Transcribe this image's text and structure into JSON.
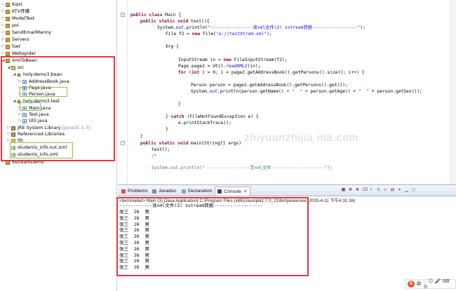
{
  "explorer": {
    "projects_top": [
      "Kqxt",
      "KTV开撑",
      "ModelTest",
      "poi",
      "SendEmailManny",
      "Servers",
      "Swt",
      "Webspider"
    ],
    "project": "XmlToBean",
    "src": "src",
    "pkg_bean": "holy.demo3.bean",
    "files_bean": [
      "AddressBook.java",
      "Page.java",
      "Person.java"
    ],
    "pkg_test": "holy.demo3.test",
    "files_test": [
      "Main.java",
      "Test.java",
      "Util.java"
    ],
    "jre": "JRE System Library",
    "jre_version": "[JavaSE-1.7]",
    "ref_libs": "Referenced Libraries",
    "lib": "lib",
    "xml_out": "students_info.out.xml",
    "xml_in": "students_info.xml",
    "xstream_demo": "xstreamDemo"
  },
  "editor": {
    "lines": [
      {
        "i": 0,
        "segs": [
          [
            "kw",
            "public class"
          ],
          [
            "t",
            " Main {"
          ]
        ]
      },
      {
        "i": 1,
        "segs": [
          [
            "kw",
            "public static void"
          ],
          [
            "t",
            " test(){"
          ]
        ]
      },
      {
        "i": 2,
        "segs": [
          [
            "t",
            "System."
          ],
          [
            "fld",
            "out"
          ],
          [
            "t",
            ".println("
          ],
          [
            "str",
            "\"----------------读xml文件(2) xstream转换-----------------\""
          ],
          [
            "t",
            ");"
          ]
        ]
      },
      {
        "i": 3,
        "segs": [
          [
            "t",
            "File f2 = "
          ],
          [
            "kw",
            "new"
          ],
          [
            "t",
            " File("
          ],
          [
            "str",
            "\"e://testXtram.xml\""
          ],
          [
            "t",
            ");"
          ]
        ]
      },
      {
        "i": 4,
        "segs": []
      },
      {
        "i": 5,
        "segs": [
          [
            "kw",
            "try"
          ],
          [
            "t",
            " {"
          ]
        ]
      },
      {
        "i": 6,
        "segs": []
      },
      {
        "i": 7,
        "segs": [
          [
            "t",
            "InputStream in = "
          ],
          [
            "kw",
            "new"
          ],
          [
            "t",
            " FileInputStream(f2);"
          ]
        ]
      },
      {
        "i": 8,
        "segs": [
          [
            "t",
            "Page page2 = Util."
          ],
          [
            "fld",
            "readXML2"
          ],
          [
            "t",
            "(in);"
          ]
        ]
      },
      {
        "i": 9,
        "segs": [
          [
            "kw",
            "for"
          ],
          [
            "t",
            " ("
          ],
          [
            "kw",
            "int"
          ],
          [
            "t",
            " i = 0; i < page2.getAddressBook().getPersons().size(); i++) {"
          ]
        ]
      },
      {
        "i": 10,
        "segs": []
      },
      {
        "i": 11,
        "segs": [
          [
            "t",
            "Person person = page2.getAddressBook().getPersons().get(i);"
          ]
        ]
      },
      {
        "i": 12,
        "segs": [
          [
            "t",
            "System."
          ],
          [
            "fld",
            "out"
          ],
          [
            "t",
            ".println(person.getName() + "
          ],
          [
            "str",
            "\"  \""
          ],
          [
            "t",
            " + person.getAge() + "
          ],
          [
            "str",
            "\"  \""
          ],
          [
            "t",
            " + person.getSex());"
          ]
        ]
      },
      {
        "i": 13,
        "segs": []
      },
      {
        "i": 14,
        "segs": [
          [
            "t",
            "}"
          ]
        ]
      },
      {
        "i": 15,
        "segs": []
      },
      {
        "i": 16,
        "segs": [
          [
            "t",
            "} "
          ],
          [
            "kw",
            "catch"
          ],
          [
            "t",
            " (FileNotFoundException e) {"
          ]
        ]
      },
      {
        "i": 17,
        "segs": [
          [
            "t",
            "e.printStackTrace();"
          ]
        ]
      },
      {
        "i": 18,
        "segs": [
          [
            "t",
            "}"
          ]
        ]
      },
      {
        "i": 19,
        "segs": []
      },
      {
        "i": 20,
        "segs": [
          [
            "t",
            "}"
          ]
        ]
      },
      {
        "i": 21,
        "segs": [
          [
            "kw",
            "public static void"
          ],
          [
            "t",
            " main(String[] args)"
          ]
        ]
      },
      {
        "i": 22,
        "segs": [
          [
            "t",
            "test();"
          ]
        ]
      },
      {
        "i": 23,
        "segs": [
          [
            "cmt",
            "/*"
          ]
        ]
      },
      {
        "i": 24,
        "segs": []
      },
      {
        "i": 25,
        "segs": [
          [
            "cmt",
            "System.out.println(\"-----------------写xml文件--------------------\");"
          ]
        ]
      }
    ],
    "watermark": "zhiyuanzhijia ma.com"
  },
  "views": {
    "tabs": [
      "Problems",
      "Javadoc",
      "Declaration",
      "Console"
    ],
    "active_tab": "Console",
    "console_header": "<terminated> Main (3) [Java Application] C:\\Program Files (x86)\\Java\\jdk1.7.0_21\\bin\\javaw.exe (2015-4-11 下午4:31:36)",
    "console_title_line": "------------读xml文件(2) xstream转换------------------",
    "console_rows": [
      "张三  26  男",
      "张三  26  男",
      "张三  26  男",
      "张三  26  男",
      "张三  26  男",
      "张三  26  男",
      "张三  26  男",
      "张三  26  男",
      "张三  26  男",
      "张三  26  男"
    ]
  },
  "ime": {
    "logo": "S",
    "mode": "中",
    "symbols": "·, ☺ 🎤 ⌨ ⚙"
  },
  "colors": {
    "highlight_red": "#e3373f",
    "highlight_green": "#8bc34a",
    "keyword": "#7f0055",
    "string": "#2a00ff"
  }
}
